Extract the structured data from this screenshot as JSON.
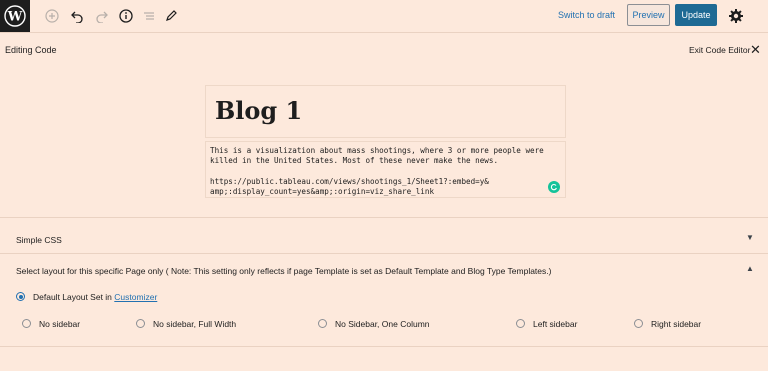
{
  "toolbar": {
    "switch_to_draft": "Switch to draft",
    "preview": "Preview",
    "update": "Update",
    "icons": [
      "wordpress-logo-icon",
      "add-block-icon",
      "undo-icon",
      "redo-icon",
      "details-icon",
      "list-view-icon",
      "tools-pencil-icon",
      "settings-gear-icon"
    ],
    "accent": "#1e6a94"
  },
  "editor_mode": {
    "label": "Editing Code",
    "exit": "Exit Code Editor"
  },
  "post": {
    "title": "Blog 1",
    "content_line1": "This is a visualization about mass shootings, where 3 or more people were",
    "content_line2": "killed in the United States. Most of these never make the news.",
    "content_line3": "https://public.tableau.com/views/shootings_1/Sheet1?:embed=y&",
    "content_line4": "amp;:display_count=yes&amp;:origin=viz_share_link"
  },
  "panels": {
    "simple_css": "Simple CSS",
    "layout_title": "Select layout for this specific Page only ( Note: This setting only reflects if page Template is set as Default Template and Blog Type Templates.)",
    "default_layout_prefix": "Default Layout Set in",
    "customizer_link": "Customizer",
    "options": [
      "No sidebar",
      "No sidebar, Full Width",
      "No Sidebar, One Column",
      "Left sidebar",
      "Right sidebar"
    ],
    "selected": "Default Layout Set in Customizer"
  },
  "background": "#fde9dc"
}
